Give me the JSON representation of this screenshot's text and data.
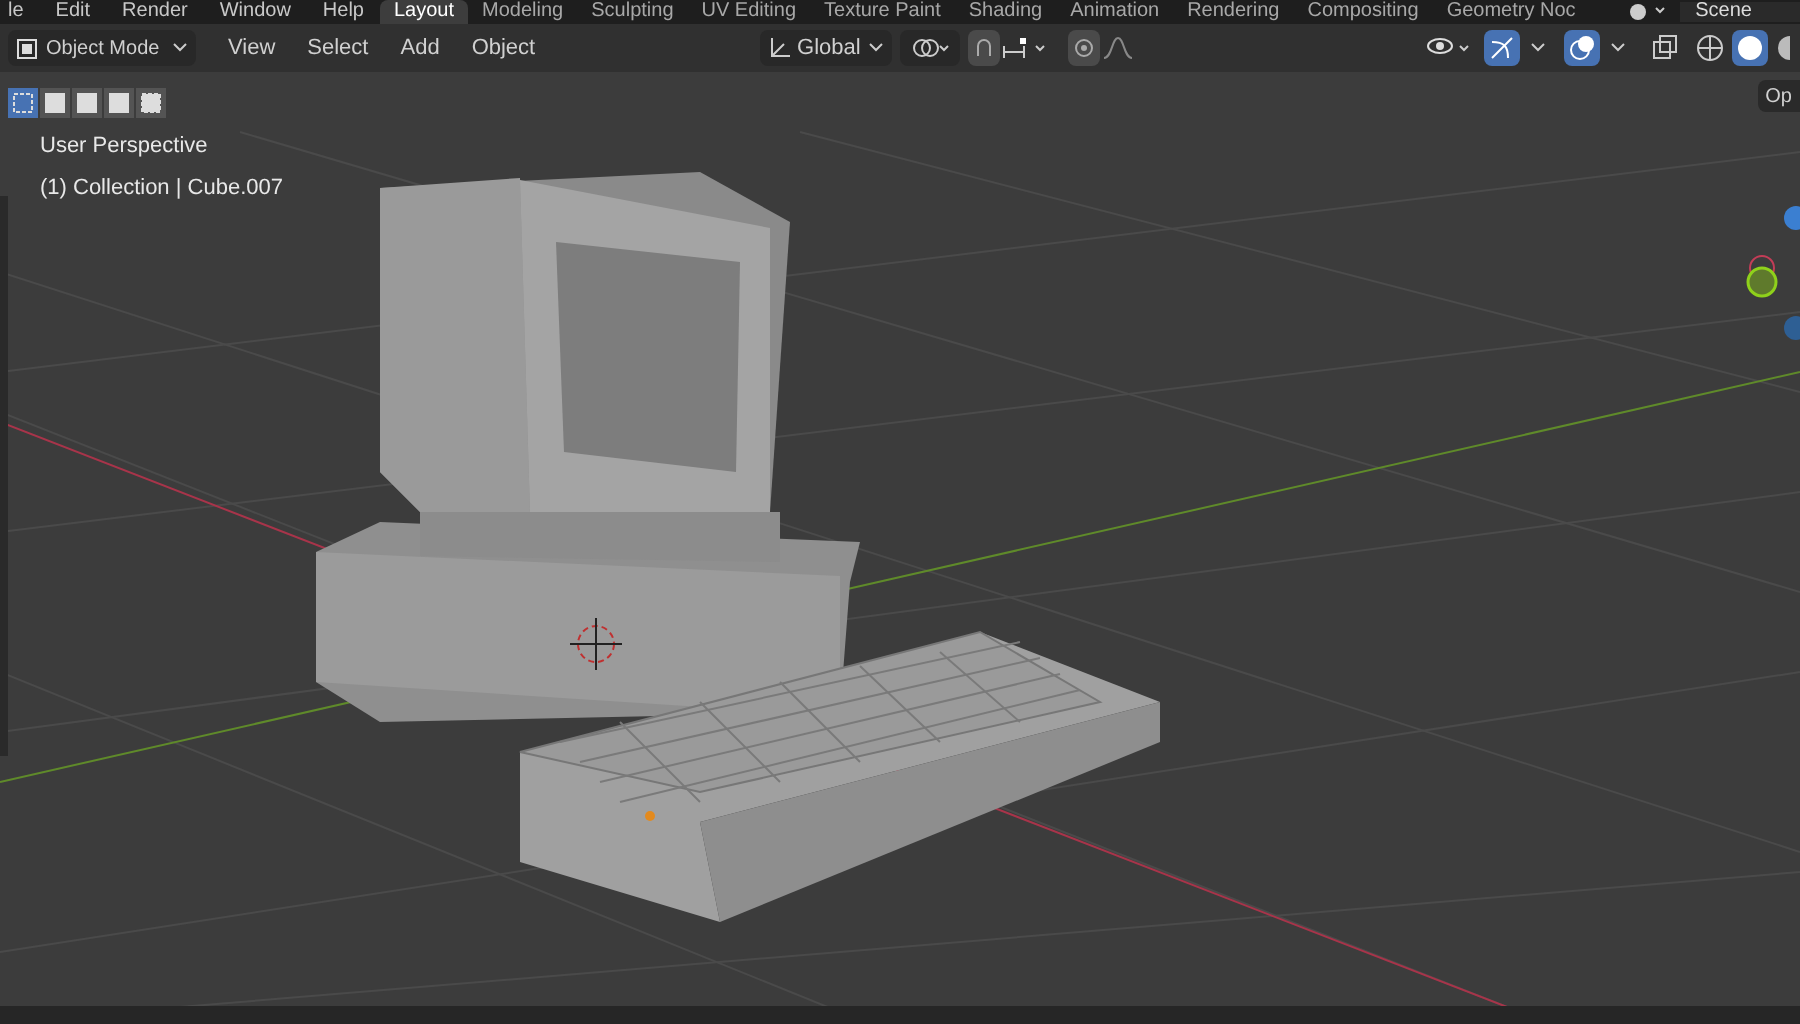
{
  "menu": [
    "le",
    "Edit",
    "Render",
    "Window",
    "Help"
  ],
  "workspaces": [
    {
      "label": "Layout",
      "selected": true
    },
    {
      "label": "Modeling",
      "selected": false
    },
    {
      "label": "Sculpting",
      "selected": false
    },
    {
      "label": "UV Editing",
      "selected": false
    },
    {
      "label": "Texture Paint",
      "selected": false
    },
    {
      "label": "Shading",
      "selected": false
    },
    {
      "label": "Animation",
      "selected": false
    },
    {
      "label": "Rendering",
      "selected": false
    },
    {
      "label": "Compositing",
      "selected": false
    },
    {
      "label": "Geometry Noc",
      "selected": false
    }
  ],
  "scene": "Scene",
  "header": {
    "mode": "Object Mode",
    "menus": [
      "View",
      "Select",
      "Add",
      "Object"
    ],
    "orientation": "Global",
    "options_button": "Op"
  },
  "select_modes": [
    {
      "selected": true
    },
    {
      "selected": false
    },
    {
      "selected": false
    },
    {
      "selected": false
    },
    {
      "selected": false
    }
  ],
  "toggles": {
    "snap": false,
    "proportional": false,
    "gizmos": true,
    "overlays": true,
    "solid_shading": true
  },
  "viewport": {
    "view_name": "User Perspective",
    "object_info": "(1) Collection | Cube.007"
  }
}
